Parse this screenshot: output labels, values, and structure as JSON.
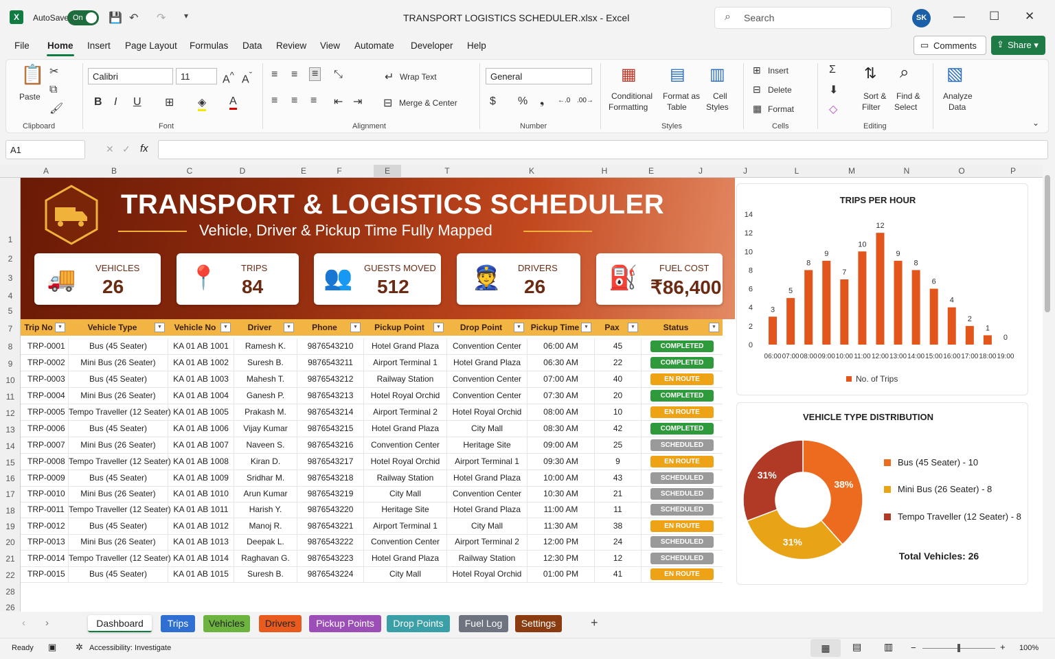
{
  "titlebar": {
    "autosave_label": "AutoSave",
    "autosave_state": "On",
    "doc_title": "TRANSPORT LOGISTICS SCHEDULER.xlsx  -  Excel",
    "search_placeholder": "Search",
    "avatar": "SK"
  },
  "menu": {
    "items": [
      "File",
      "Home",
      "Insert",
      "Page Layout",
      "Formulas",
      "Data",
      "Review",
      "View",
      "Automate",
      "Developer",
      "Help"
    ],
    "comments": "Comments",
    "share": "Share"
  },
  "ribbon": {
    "paste": "Paste",
    "font_name": "Calibri",
    "font_size": "11",
    "wrap_text": "Wrap Text",
    "merge_center": "Merge & Center",
    "number_format": "General",
    "conditional": "Conditional",
    "formatting": "Formatting",
    "format_as": "Format as",
    "table": "Table",
    "cell": "Cell",
    "styles_btn": "Styles",
    "insert": "Insert",
    "delete": "Delete",
    "format": "Format",
    "sort": "Sort &",
    "filter": "Filter",
    "find": "Find &",
    "select": "Select",
    "analyze": "Analyze",
    "data_lbl": "Data",
    "groups": [
      "Clipboard",
      "Font",
      "Alignment",
      "Number",
      "Styles",
      "Cells",
      "Editing"
    ]
  },
  "formula": {
    "namebox": "A1"
  },
  "columns": [
    "A",
    "B",
    "C",
    "D",
    "E",
    "F",
    "E",
    "T",
    "K",
    "H",
    "E",
    "J",
    "J",
    "L",
    "M",
    "N",
    "O",
    "P"
  ],
  "rows": [
    "1",
    "2",
    "3",
    "4",
    "5",
    "7",
    "8",
    "9",
    "10",
    "11",
    "12",
    "13",
    "14",
    "15",
    "16",
    "17",
    "18",
    "19",
    "20",
    "21",
    "22",
    "28",
    "26"
  ],
  "banner": {
    "title": "TRANSPORT & LOGISTICS SCHEDULER",
    "subtitle": "Vehicle, Driver & Pickup Time Fully Mapped"
  },
  "kpis": [
    {
      "label": "VEHICLES",
      "value": "26",
      "icon": "truck-icon"
    },
    {
      "label": "TRIPS",
      "value": "84",
      "icon": "route-icon"
    },
    {
      "label": "GUESTS MOVED",
      "value": "512",
      "icon": "people-icon"
    },
    {
      "label": "DRIVERS",
      "value": "26",
      "icon": "driver-icon"
    },
    {
      "label": "FUEL COST",
      "value": "₹86,400",
      "icon": "fuel-icon"
    }
  ],
  "table": {
    "headers": [
      "Trip No",
      "Vehicle Type",
      "Vehicle No",
      "Driver",
      "Phone",
      "Pickup Point",
      "Drop Point",
      "Pickup Time",
      "Pax",
      "Status"
    ],
    "rows": [
      [
        "TRP-0001",
        "Bus (45 Seater)",
        "KA 01 AB 1001",
        "Ramesh K.",
        "9876543210",
        "Hotel Grand Plaza",
        "Convention Center",
        "06:00 AM",
        "45",
        "COMPLETED"
      ],
      [
        "TRP-0002",
        "Mini Bus (26 Seater)",
        "KA 01 AB 1002",
        "Suresh B.",
        "9876543211",
        "Airport Terminal 1",
        "Hotel Grand Plaza",
        "06:30 AM",
        "22",
        "COMPLETED"
      ],
      [
        "TRP-0003",
        "Bus (45 Seater)",
        "KA 01 AB 1003",
        "Mahesh T.",
        "9876543212",
        "Railway Station",
        "Convention Center",
        "07:00 AM",
        "40",
        "EN ROUTE"
      ],
      [
        "TRP-0004",
        "Mini Bus (26 Seater)",
        "KA 01 AB 1004",
        "Ganesh P.",
        "9876543213",
        "Hotel Royal Orchid",
        "Convention Center",
        "07:30 AM",
        "20",
        "COMPLETED"
      ],
      [
        "TRP-0005",
        "Tempo Traveller (12 Seater)",
        "KA 01 AB 1005",
        "Prakash M.",
        "9876543214",
        "Airport Terminal 2",
        "Hotel Royal Orchid",
        "08:00 AM",
        "10",
        "EN ROUTE"
      ],
      [
        "TRP-0006",
        "Bus (45 Seater)",
        "KA 01 AB 1006",
        "Vijay Kumar",
        "9876543215",
        "Hotel Grand Plaza",
        "City Mall",
        "08:30 AM",
        "42",
        "COMPLETED"
      ],
      [
        "TRP-0007",
        "Mini Bus (26 Seater)",
        "KA 01 AB 1007",
        "Naveen S.",
        "9876543216",
        "Convention Center",
        "Heritage Site",
        "09:00 AM",
        "25",
        "SCHEDULED"
      ],
      [
        "TRP-0008",
        "Tempo Traveller (12 Seater)",
        "KA 01 AB 1008",
        "Kiran D.",
        "9876543217",
        "Hotel Royal Orchid",
        "Airport Terminal 1",
        "09:30 AM",
        "9",
        "EN ROUTE"
      ],
      [
        "TRP-0009",
        "Bus (45 Seater)",
        "KA 01 AB 1009",
        "Sridhar M.",
        "9876543218",
        "Railway Station",
        "Hotel Grand Plaza",
        "10:00 AM",
        "43",
        "SCHEDULED"
      ],
      [
        "TRP-0010",
        "Mini Bus (26 Seater)",
        "KA 01 AB 1010",
        "Arun Kumar",
        "9876543219",
        "City Mall",
        "Convention Center",
        "10:30 AM",
        "21",
        "SCHEDULED"
      ],
      [
        "TRP-0011",
        "Tempo Traveller (12 Seater)",
        "KA 01 AB 1011",
        "Harish Y.",
        "9876543220",
        "Heritage Site",
        "Hotel Grand Plaza",
        "11:00 AM",
        "11",
        "SCHEDULED"
      ],
      [
        "TRP-0012",
        "Bus (45 Seater)",
        "KA 01 AB 1012",
        "Manoj R.",
        "9876543221",
        "Airport Terminal 1",
        "City Mall",
        "11:30 AM",
        "38",
        "EN ROUTE"
      ],
      [
        "TRP-0013",
        "Mini Bus (26 Seater)",
        "KA 01 AB 1013",
        "Deepak L.",
        "9876543222",
        "Convention Center",
        "Airport Terminal 2",
        "12:00 PM",
        "24",
        "SCHEDULED"
      ],
      [
        "TRP-0014",
        "Tempo Traveller (12 Seater)",
        "KA 01 AB 1014",
        "Raghavan G.",
        "9876543223",
        "Hotel Grand Plaza",
        "Railway Station",
        "12:30 PM",
        "12",
        "SCHEDULED"
      ],
      [
        "TRP-0015",
        "Bus (45 Seater)",
        "KA 01 AB 1015",
        "Suresh B.",
        "9876543224",
        "City Mall",
        "Hotel Royal Orchid",
        "01:00 PM",
        "41",
        "EN ROUTE"
      ]
    ],
    "status_colors": {
      "COMPLETED": "#2f9a3c",
      "EN ROUTE": "#eea215",
      "SCHEDULED": "#9a9a9a"
    }
  },
  "chart_data": [
    {
      "type": "bar",
      "title": "TRIPS PER HOUR",
      "categories": [
        "06:00",
        "07:00",
        "08:00",
        "09:00",
        "10:00",
        "11:00",
        "12:00",
        "13:00",
        "14:00",
        "15:00",
        "16:00",
        "17:00",
        "18:00",
        "19:00"
      ],
      "series": [
        {
          "name": "No. of Trips",
          "values": [
            3,
            5,
            8,
            9,
            7,
            10,
            12,
            9,
            8,
            6,
            4,
            2,
            1,
            0
          ]
        }
      ],
      "ylim": [
        0,
        14
      ],
      "yticks": [
        "0",
        "2",
        "4",
        "6",
        "8",
        "10",
        "12",
        "14"
      ],
      "color": "#e2561b",
      "legend": "bottom"
    },
    {
      "type": "pie",
      "title": "VEHICLE TYPE DISTRIBUTION",
      "slices": [
        {
          "label": "Bus (45 Seater) - 10",
          "value": 10,
          "pct": "38%",
          "color": "#ec6b1f"
        },
        {
          "label": "Mini Bus (26 Seater) - 8",
          "value": 8,
          "pct": "31%",
          "color": "#e8a316"
        },
        {
          "label": "Tempo Traveller (12 Seater) - 8",
          "value": 8,
          "pct": "31%",
          "color": "#b03a26"
        }
      ],
      "total": "Total Vehicles: 26",
      "legend": "right"
    }
  ],
  "sheet_tabs": [
    {
      "name": "Dashboard",
      "color": "#ffffff",
      "text": "#222"
    },
    {
      "name": "Trips",
      "color": "#2e6fd1",
      "text": "#fff"
    },
    {
      "name": "Vehicles",
      "color": "#6cb33f",
      "text": "#222"
    },
    {
      "name": "Drivers",
      "color": "#e85a1e",
      "text": "#222"
    },
    {
      "name": "Pickup Points",
      "color": "#9b4fb6",
      "text": "#fff"
    },
    {
      "name": "Drop Points",
      "color": "#3a9fa6",
      "text": "#fff"
    },
    {
      "name": "Fuel Log",
      "color": "#6d7480",
      "text": "#fff"
    },
    {
      "name": "Settings",
      "color": "#8a3c10",
      "text": "#fff"
    }
  ],
  "statusbar": {
    "ready": "Ready",
    "accessibility": "Accessibility: Investigate",
    "zoom": "100%"
  }
}
